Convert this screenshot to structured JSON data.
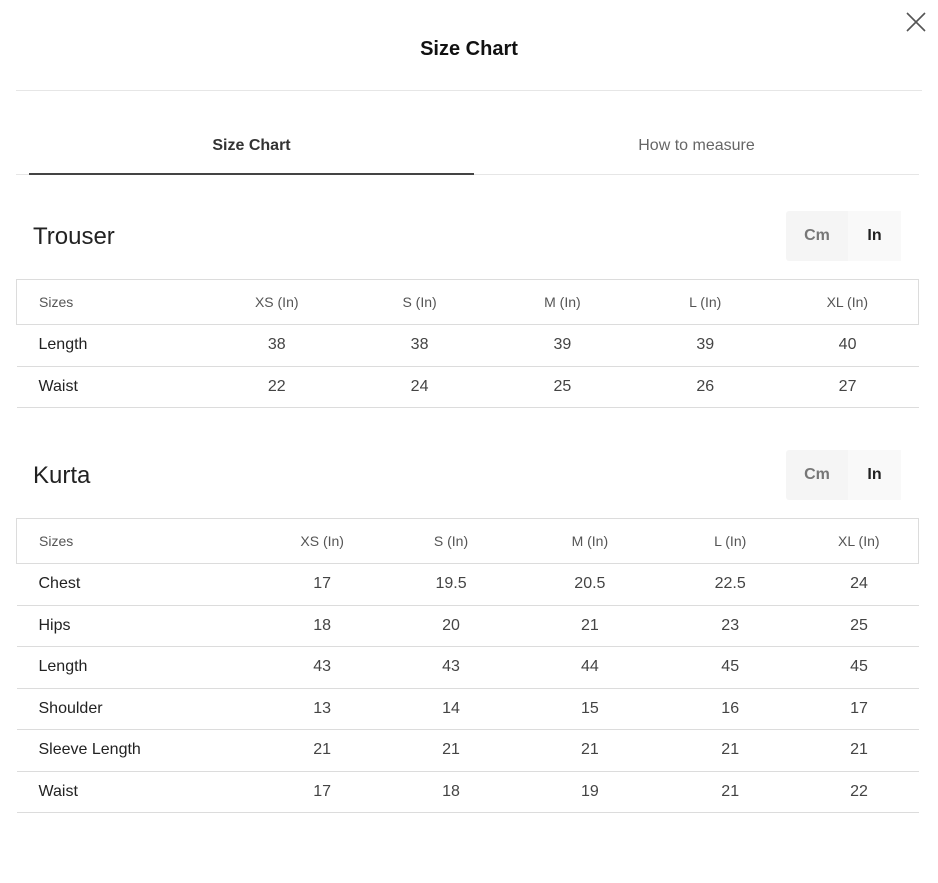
{
  "modal": {
    "title": "Size Chart"
  },
  "tabs": [
    {
      "label": "Size Chart",
      "active": true
    },
    {
      "label": "How to measure",
      "active": false
    }
  ],
  "units": {
    "cm": "Cm",
    "in": "In",
    "selected": "In"
  },
  "trouser": {
    "title": "Trouser",
    "headers": [
      "Sizes",
      "XS (In)",
      "S (In)",
      "M (In)",
      "L (In)",
      "XL (In)"
    ],
    "rows": [
      [
        "Length",
        "38",
        "38",
        "39",
        "39",
        "40"
      ],
      [
        "Waist",
        "22",
        "24",
        "25",
        "26",
        "27"
      ]
    ]
  },
  "kurta": {
    "title": "Kurta",
    "headers": [
      "Sizes",
      "XS (In)",
      "S (In)",
      "M (In)",
      "L (In)",
      "XL (In)"
    ],
    "rows": [
      [
        "Chest",
        "17",
        "19.5",
        "20.5",
        "22.5",
        "24"
      ],
      [
        "Hips",
        "18",
        "20",
        "21",
        "23",
        "25"
      ],
      [
        "Length",
        "43",
        "43",
        "44",
        "45",
        "45"
      ],
      [
        "Shoulder",
        "13",
        "14",
        "15",
        "16",
        "17"
      ],
      [
        "Sleeve Length",
        "21",
        "21",
        "21",
        "21",
        "21"
      ],
      [
        "Waist",
        "17",
        "18",
        "19",
        "21",
        "22"
      ]
    ]
  }
}
